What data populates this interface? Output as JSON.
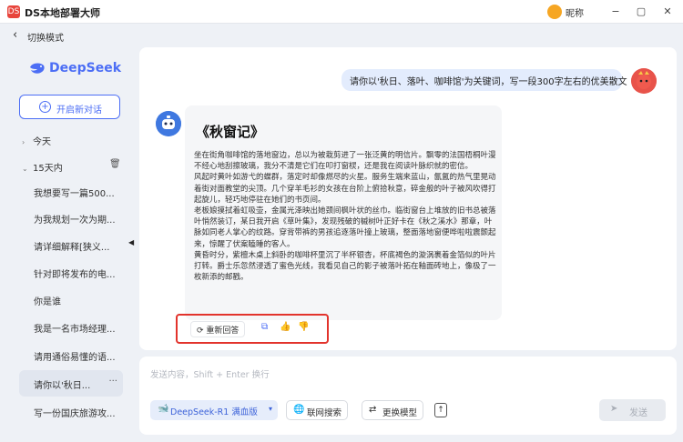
{
  "app": {
    "title": "DS本地部署大师",
    "logo_text": "DS",
    "user_name": "昵称",
    "window_controls": [
      "minimize-icon",
      "maximize-icon",
      "close-icon"
    ]
  },
  "subbar": {
    "back_label": "切换模式"
  },
  "sidebar": {
    "brand_name": "DeepSeek",
    "new_chat_label": "开启新对话",
    "groups": [
      {
        "label": "今天",
        "expanded": false
      },
      {
        "label": "15天内",
        "expanded": true
      }
    ],
    "history": [
      {
        "title": "我想要写一篇500..."
      },
      {
        "title": "为我规划一次为期..."
      },
      {
        "title": "请详细解释[狭义..."
      },
      {
        "title": "针对即将发布的电..."
      },
      {
        "title": "你是谁"
      },
      {
        "title": "我是一名市场经理..."
      },
      {
        "title": "请用通俗易懂的语..."
      },
      {
        "title": "请你以'秋日...",
        "active": true,
        "more": "···"
      },
      {
        "title": "写一份国庆旅游攻..."
      }
    ]
  },
  "conversation": {
    "user_message": "请你以'秋日、落叶、咖啡馆'为关键词，写一段300字左右的优美散文",
    "essay_title": "《秋窗记》",
    "essay_paragraphs": [
      "坐在街角咖啡馆的落地窗边，总以为被栽剪进了一张泛黄的明信片。飘零的法国梧桐叶漫不经心地刮擦玻璃，我分不清是它们在叩打窗棂，还是我在阅读叶脉织就的密信。",
      "风起时黄叶如游弋的蝶群，落定时却像燃尽的火星。服务生端来蓝山，氤氲的热气里晃动着街对面教堂的尖顶。几个穿羊毛衫的女孩在台阶上俯拾秋意，碎金般的叶子被风吹得打起旋儿，轻巧地停驻在她们的书页间。",
      "老板娘摸拭着虹吸壶，金属光泽映出她颈间枫叶状的丝巾。临街窗台上堆放的旧书总被落叶悄然装订，某日我开启《草叶集》，发现残破的槭树叶正好卡在《秋之溪水》那章，叶脉如同老人掌心的纹路。穿背带裤的男孩追逐落叶撞上玻璃，整面落地窗便哗啦啦震颤起来，惊醒了伏案瞌睡的客人。",
      "黄昏时分，紫檀木桌上斜卧的咖啡杯里沉了半杯银杏，杯底褐色的漩涡裹着金箔似的叶片打转。爵士乐忽然浸透了蜜色光线，我看见自己的影子被落叶拓在釉面砖地上，像极了一枚新添的邮戳。"
    ],
    "actions": {
      "regenerate_label": "重新回答",
      "icons": [
        "copy-icon",
        "thumbs-up-icon",
        "thumbs-down-icon"
      ]
    }
  },
  "composer": {
    "placeholder": "发送内容，Shift + Enter 换行",
    "model_label": "DeepSeek-R1 满血版",
    "web_search_label": "联网搜索",
    "switch_model_label": "更换模型",
    "send_label": "发送"
  },
  "colors": {
    "accent": "#4c6ef5",
    "highlight_box": "#e2332c",
    "user_bubble": "#e3ecfd",
    "bot_card": "#f5f6f8"
  }
}
